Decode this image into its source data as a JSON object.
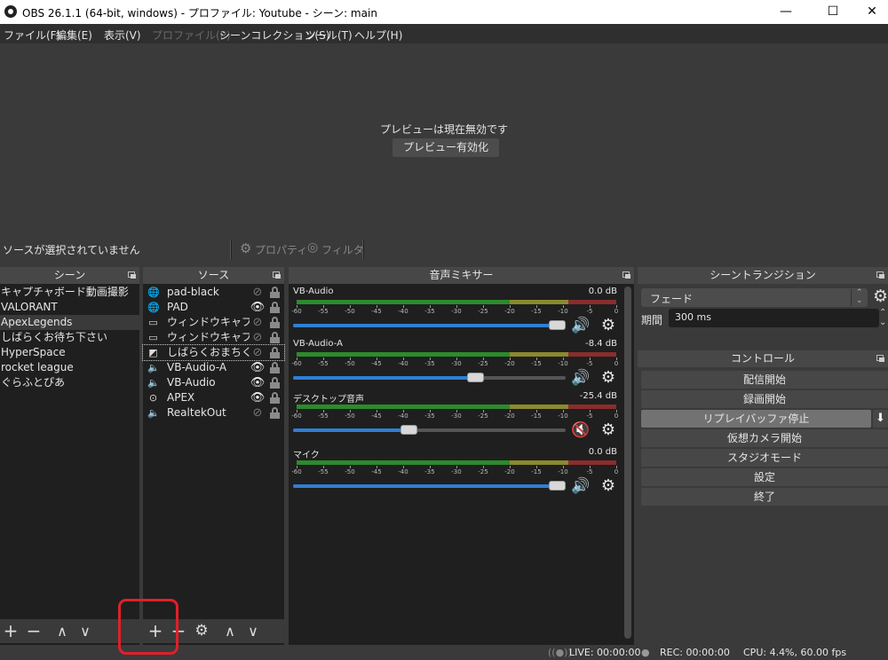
{
  "window": {
    "title": "OBS 26.1.1 (64-bit, windows) - プロファイル: Youtube - シーン: main",
    "controls": {
      "minimize": "—",
      "maximize": "☐",
      "close": "✕"
    }
  },
  "menu": [
    {
      "label": "ファイル(F)",
      "disabled": false
    },
    {
      "label": "編集(E)",
      "disabled": false
    },
    {
      "label": "表示(V)",
      "disabled": false
    },
    {
      "label": "プロファイル(P)",
      "disabled": true
    },
    {
      "label": "シーンコレクション(S)",
      "disabled": false
    },
    {
      "label": "ツール(T)",
      "disabled": false
    },
    {
      "label": "ヘルプ(H)",
      "disabled": false
    }
  ],
  "preview": {
    "message": "プレビューは現在無効です",
    "enable_button": "プレビュー有効化"
  },
  "source_bar": {
    "no_selection": "ソースが選択されていません",
    "properties": "プロパティ",
    "filters": "フィルタ"
  },
  "scenes": {
    "title": "シーン",
    "items": [
      {
        "label": "キャプチャボード動画撮影",
        "selected": false
      },
      {
        "label": "VALORANT",
        "selected": false
      },
      {
        "label": "ApexLegends",
        "selected": true
      },
      {
        "label": "しばらくお待ち下さい",
        "selected": false
      },
      {
        "label": "HyperSpace",
        "selected": false
      },
      {
        "label": "rocket league",
        "selected": false
      },
      {
        "label": "ぐらふとぴあ",
        "selected": false
      }
    ],
    "toolbar": {
      "add": "+",
      "remove": "−",
      "up": "∧",
      "down": "∨"
    }
  },
  "sources": {
    "title": "ソース",
    "items": [
      {
        "label": "pad-black",
        "icon": "globe-icon",
        "glyph": "🌐",
        "visible": false
      },
      {
        "label": "PAD",
        "icon": "globe-icon",
        "glyph": "🌐",
        "visible": true
      },
      {
        "label": "ウィンドウキャプチャ",
        "icon": "window-icon",
        "glyph": "▭",
        "visible": false
      },
      {
        "label": "ウィンドウキャプチャ",
        "icon": "window-icon",
        "glyph": "▭",
        "visible": false
      },
      {
        "label": "しばらくおまちくださ",
        "icon": "image-icon",
        "glyph": "◩",
        "visible": false
      },
      {
        "label": "VB-Audio-A",
        "icon": "speaker-icon",
        "glyph": "🔈",
        "visible": true
      },
      {
        "label": "VB-Audio",
        "icon": "speaker-icon",
        "glyph": "🔈",
        "visible": true
      },
      {
        "label": "APEX",
        "icon": "gamepad-icon",
        "glyph": "⊙",
        "visible": true
      },
      {
        "label": "RealtekOut",
        "icon": "speaker-icon",
        "glyph": "🔈",
        "visible": false
      }
    ],
    "eye_on": "👁",
    "eye_off": "⊘",
    "toolbar": {
      "add": "+",
      "remove": "−",
      "settings": "⚙",
      "up": "∧",
      "down": "∨"
    }
  },
  "mixer": {
    "title": "音声ミキサー",
    "scale": [
      "-60",
      "-55",
      "-50",
      "-45",
      "-40",
      "-35",
      "-30",
      "-25",
      "-20",
      "-15",
      "-10",
      "-5",
      "0"
    ],
    "channels": [
      {
        "name": "VB-Audio",
        "db": "0.0 dB",
        "volume_percent": 100,
        "muted": false
      },
      {
        "name": "VB-Audio-A",
        "db": "-8.4 dB",
        "volume_percent": 68,
        "muted": false
      },
      {
        "name": "デスクトップ音声",
        "db": "-25.4 dB",
        "volume_percent": 42,
        "muted": true
      },
      {
        "name": "マイク",
        "db": "0.0 dB",
        "volume_percent": 100,
        "muted": false
      }
    ],
    "speaker_glyph": "🔊",
    "muted_glyph": "🔇",
    "gear_glyph": "⚙"
  },
  "transitions": {
    "title": "シーントランジション",
    "selected": "フェード",
    "duration_label": "期間",
    "duration_value": "300 ms"
  },
  "controls": {
    "title": "コントロール",
    "buttons": [
      {
        "label": "配信開始",
        "active": false
      },
      {
        "label": "録画開始",
        "active": false
      },
      {
        "label": "リプレイバッファ停止",
        "active": true
      },
      {
        "label": "仮想カメラ開始",
        "active": false
      },
      {
        "label": "スタジオモード",
        "active": false
      },
      {
        "label": "設定",
        "active": false
      },
      {
        "label": "終了",
        "active": false
      }
    ],
    "save_replay_glyph": "⬇"
  },
  "status": {
    "live": "LIVE: 00:00:00",
    "rec": "REC: 00:00:00",
    "cpu": "CPU: 4.4%, 60.00 fps"
  },
  "colors": {
    "highlight": "#e0202a",
    "volume_fill": "#2f7fd4",
    "mute_red": "#d01010"
  }
}
